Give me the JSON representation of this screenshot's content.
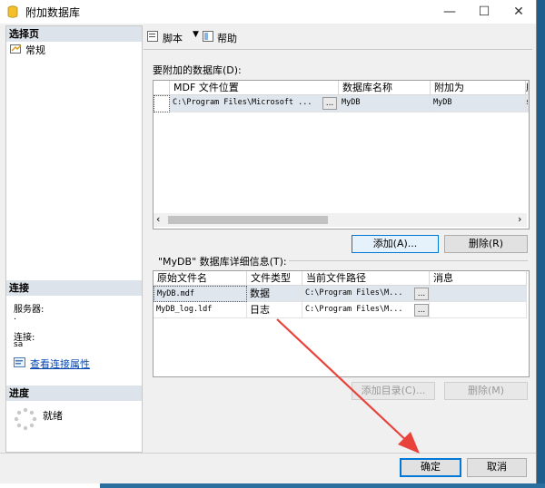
{
  "window": {
    "title": "附加数据库",
    "minimize": "—",
    "maximize": "☐",
    "close": "✕"
  },
  "left": {
    "select_page_header": "选择页",
    "general_item": "常规",
    "connection_header": "连接",
    "server_label": "服务器:",
    "server_value": ".",
    "connection_label": "连接:",
    "connection_value": "sa",
    "view_conn_link": "查看连接属性",
    "progress_header": "进度",
    "progress_status": "就绪"
  },
  "toolbar": {
    "script_label": "脚本",
    "help_label": "帮助"
  },
  "attach": {
    "section_label": "要附加的数据库(D):",
    "columns": [
      "MDF 文件位置",
      "数据库名称",
      "附加为",
      "所"
    ],
    "row": {
      "mdf_path": "C:\\Program Files\\Microsoft ...",
      "dots": "...",
      "db_name": "MyDB",
      "attach_as": "MyDB",
      "extra": "s"
    },
    "add_button": "添加(A)...",
    "remove_button": "删除(R)"
  },
  "details": {
    "section_label": "\"MyDB\" 数据库详细信息(T):",
    "columns": [
      "原始文件名",
      "文件类型",
      "当前文件路径",
      "消息"
    ],
    "rows": [
      {
        "name": "MyDB.mdf",
        "type": "数据",
        "path": "C:\\Program Files\\M...",
        "dots": "...",
        "message": ""
      },
      {
        "name": "MyDB_log.ldf",
        "type": "日志",
        "path": "C:\\Program Files\\M...",
        "dots": "...",
        "message": ""
      }
    ],
    "add_catalog_button": "添加目录(C)...",
    "remove_button": "删除(M)"
  },
  "footer": {
    "ok_button": "确定",
    "cancel_button": "取消"
  },
  "colors": {
    "annotation_arrow": "#e8423a",
    "selection": "#dfe6ee",
    "panel_header": "#dde3ea"
  }
}
